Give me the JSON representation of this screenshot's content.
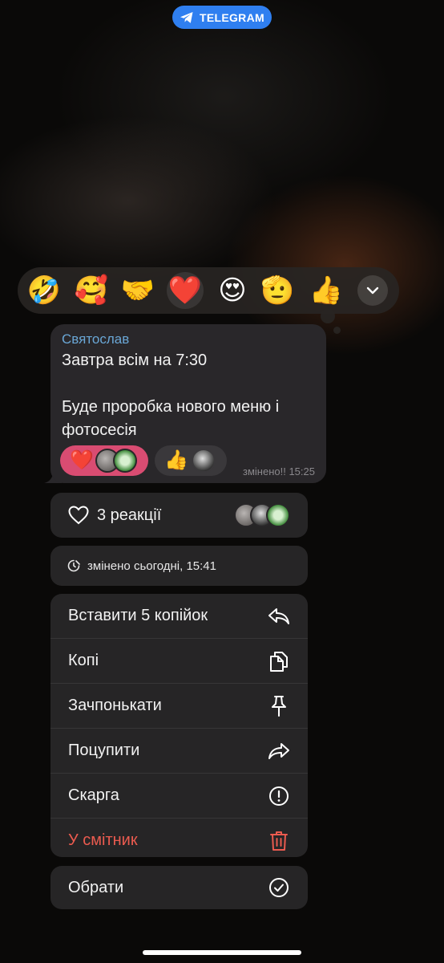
{
  "status_pill": {
    "label": "TELEGRAM"
  },
  "reaction_bar": {
    "emojis": [
      "🤣",
      "🥰",
      "🤝",
      "❤️",
      "😍",
      "🫡",
      "👍"
    ],
    "selected_index": 3
  },
  "message": {
    "sender": "Святослав",
    "lines": [
      "Завтра всім на 7:30",
      "Буде проробка нового меню і",
      "фотосесія"
    ],
    "reactions": [
      {
        "emoji": "❤️",
        "active": true
      },
      {
        "emoji": "👍",
        "active": false
      }
    ],
    "edited_label": "змінено!! 15:25"
  },
  "menu": {
    "reactions_summary": "3 реакції",
    "edited_info": "змінено сьогодні, 15:41",
    "items": [
      {
        "label": "Вставити 5 копійок",
        "icon": "reply-icon"
      },
      {
        "label": "Копі",
        "icon": "copy-icon"
      },
      {
        "label": "Зачпонькати",
        "icon": "pin-icon"
      },
      {
        "label": "Поцупити",
        "icon": "forward-icon"
      },
      {
        "label": "Скарга",
        "icon": "report-icon"
      },
      {
        "label": "У смітник",
        "icon": "trash-icon",
        "danger": true
      }
    ],
    "select_label": "Обрати"
  },
  "colors": {
    "accent_blue": "#2f7ff0",
    "sender_blue": "#6aa7d6",
    "reaction_active": "#d94c72",
    "danger": "#eb5b4f"
  }
}
